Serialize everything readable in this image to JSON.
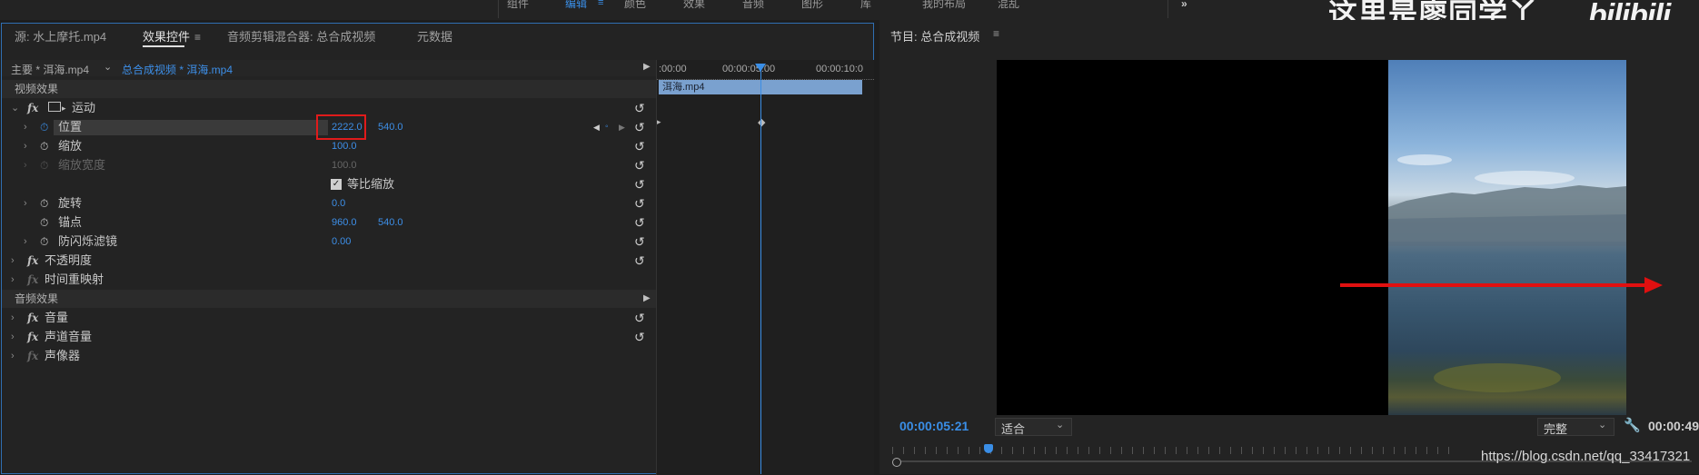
{
  "workspace_tabs": [
    {
      "label": "组件",
      "active": false
    },
    {
      "label": "编辑",
      "active": true
    },
    {
      "label": "颜色",
      "active": false
    },
    {
      "label": "效果",
      "active": false
    },
    {
      "label": "音频",
      "active": false
    },
    {
      "label": "图形",
      "active": false
    },
    {
      "label": "库",
      "active": false
    },
    {
      "label": "我的布局",
      "active": false
    },
    {
      "label": "混乱",
      "active": false
    },
    {
      "label": "»",
      "active": false
    }
  ],
  "left_panel": {
    "tabs": [
      {
        "label": "源: 水上摩托.mp4"
      },
      {
        "label": "效果控件"
      },
      {
        "label": "音频剪辑混合器: 总合成视频"
      },
      {
        "label": "元数据"
      }
    ],
    "master_label": "主要 * 洱海.mp4",
    "sequence_clip": "总合成视频 * 洱海.mp4",
    "timecodes": [
      ":00:00",
      "00:00:05:00",
      "00:00:10:0"
    ],
    "clip_name": "洱海.mp4",
    "video_effects_header": "视频效果",
    "motion_label": "运动",
    "properties": {
      "position": {
        "label": "位置",
        "x": "2222.0",
        "y": "540.0"
      },
      "scale": {
        "label": "缩放",
        "value": "100.0"
      },
      "scale_width": {
        "label": "缩放宽度",
        "value": "100.0"
      },
      "uniform_scale": {
        "label": "等比缩放",
        "checked": true
      },
      "rotation": {
        "label": "旋转",
        "value": "0.0"
      },
      "anchor": {
        "label": "锚点",
        "x": "960.0",
        "y": "540.0"
      },
      "antiflicker": {
        "label": "防闪烁滤镜",
        "value": "0.00"
      }
    },
    "opacity_label": "不透明度",
    "time_remap_label": "时间重映射",
    "audio_effects_header": "音频效果",
    "volume_label": "音量",
    "channel_volume_label": "声道音量",
    "panner_label": "声像器",
    "fx_text": "fx"
  },
  "program": {
    "title": "节目: 总合成视频",
    "timecode": "00:00:05:21",
    "fit": "适合",
    "quality": "完整",
    "duration": "00:00:49"
  },
  "watermark": {
    "text": "这里是廖同学丫",
    "logo": "bilibili"
  },
  "footer_url": "https://blog.csdn.net/qq_33417321",
  "colors": {
    "accent": "#3a8ee6",
    "highlight_box": "#e01b1b",
    "arrow": "#e01010"
  }
}
